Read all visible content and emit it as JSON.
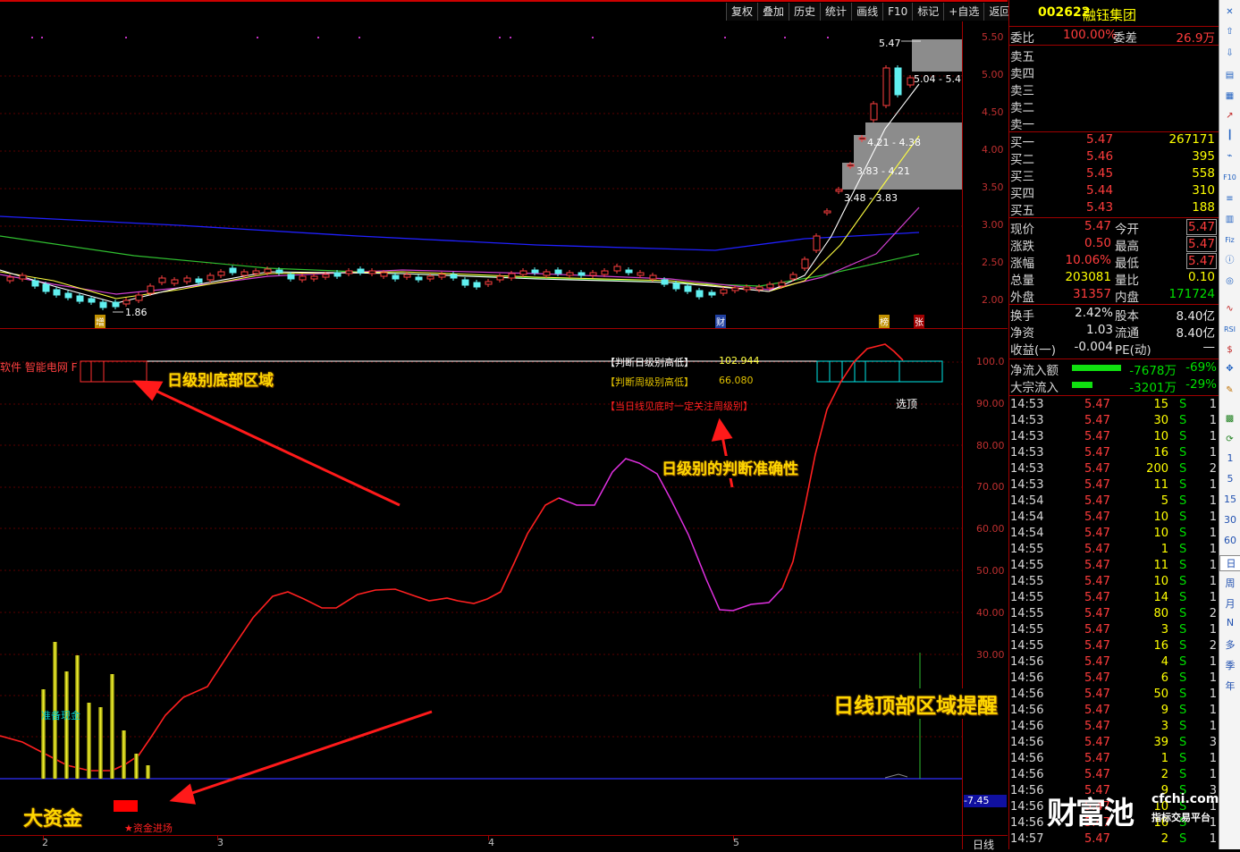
{
  "toolbar": [
    "复权",
    "叠加",
    "历史",
    "统计",
    "画线",
    "F10",
    "标记",
    "+自选",
    "返回"
  ],
  "stock": {
    "code": "002622",
    "name": "融钰集团"
  },
  "order_ratio": {
    "label1": "委比",
    "ratio": "100.00%",
    "label2": "委差",
    "diff": "26.9万"
  },
  "sell_levels": [
    "卖五",
    "卖四",
    "卖三",
    "卖二",
    "卖一"
  ],
  "buy_levels": [
    {
      "label": "买一",
      "price": "5.47",
      "vol": "267171"
    },
    {
      "label": "买二",
      "price": "5.46",
      "vol": "395"
    },
    {
      "label": "买三",
      "price": "5.45",
      "vol": "558"
    },
    {
      "label": "买四",
      "price": "5.44",
      "vol": "310"
    },
    {
      "label": "买五",
      "price": "5.43",
      "vol": "188"
    }
  ],
  "quote": [
    {
      "l1": "现价",
      "v1": "5.47",
      "l2": "今开",
      "v2": "5.47"
    },
    {
      "l1": "涨跌",
      "v1": "0.50",
      "l2": "最高",
      "v2": "5.47"
    },
    {
      "l1": "涨幅",
      "v1": "10.06%",
      "l2": "最低",
      "v2": "5.47"
    },
    {
      "l1": "总量",
      "v1": "203081",
      "l2": "量比",
      "v2": "0.10"
    },
    {
      "l1": "外盘",
      "v1": "31357",
      "l2": "内盘",
      "v2": "171724"
    }
  ],
  "fundamentals": [
    {
      "l1": "换手",
      "v1": "2.42%",
      "l2": "股本",
      "v2": "8.40亿"
    },
    {
      "l1": "净资",
      "v1": "1.03",
      "l2": "流通",
      "v2": "8.40亿"
    },
    {
      "l1": "收益(一)",
      "v1": "-0.004",
      "l2": "PE(动)",
      "v2": "—"
    }
  ],
  "flows": [
    {
      "label": "净流入额",
      "value": "-7678万",
      "pct": "-69%",
      "bar": 0.69
    },
    {
      "label": "大宗流入",
      "value": "-3201万",
      "pct": "-29%",
      "bar": 0.29
    }
  ],
  "ticks": [
    {
      "t": "14:53",
      "p": "5.47",
      "v": "15",
      "s": "S",
      "n": "1"
    },
    {
      "t": "14:53",
      "p": "5.47",
      "v": "30",
      "s": "S",
      "n": "1"
    },
    {
      "t": "14:53",
      "p": "5.47",
      "v": "10",
      "s": "S",
      "n": "1"
    },
    {
      "t": "14:53",
      "p": "5.47",
      "v": "16",
      "s": "S",
      "n": "1"
    },
    {
      "t": "14:53",
      "p": "5.47",
      "v": "200",
      "s": "S",
      "n": "2"
    },
    {
      "t": "14:53",
      "p": "5.47",
      "v": "11",
      "s": "S",
      "n": "1"
    },
    {
      "t": "14:54",
      "p": "5.47",
      "v": "5",
      "s": "S",
      "n": "1"
    },
    {
      "t": "14:54",
      "p": "5.47",
      "v": "10",
      "s": "S",
      "n": "1"
    },
    {
      "t": "14:54",
      "p": "5.47",
      "v": "10",
      "s": "S",
      "n": "1"
    },
    {
      "t": "14:55",
      "p": "5.47",
      "v": "1",
      "s": "S",
      "n": "1"
    },
    {
      "t": "14:55",
      "p": "5.47",
      "v": "11",
      "s": "S",
      "n": "1"
    },
    {
      "t": "14:55",
      "p": "5.47",
      "v": "10",
      "s": "S",
      "n": "1"
    },
    {
      "t": "14:55",
      "p": "5.47",
      "v": "14",
      "s": "S",
      "n": "1"
    },
    {
      "t": "14:55",
      "p": "5.47",
      "v": "80",
      "s": "S",
      "n": "2"
    },
    {
      "t": "14:55",
      "p": "5.47",
      "v": "3",
      "s": "S",
      "n": "1"
    },
    {
      "t": "14:55",
      "p": "5.47",
      "v": "16",
      "s": "S",
      "n": "2"
    },
    {
      "t": "14:56",
      "p": "5.47",
      "v": "4",
      "s": "S",
      "n": "1"
    },
    {
      "t": "14:56",
      "p": "5.47",
      "v": "6",
      "s": "S",
      "n": "1"
    },
    {
      "t": "14:56",
      "p": "5.47",
      "v": "50",
      "s": "S",
      "n": "1"
    },
    {
      "t": "14:56",
      "p": "5.47",
      "v": "9",
      "s": "S",
      "n": "1"
    },
    {
      "t": "14:56",
      "p": "5.47",
      "v": "3",
      "s": "S",
      "n": "1"
    },
    {
      "t": "14:56",
      "p": "5.47",
      "v": "39",
      "s": "S",
      "n": "3"
    },
    {
      "t": "14:56",
      "p": "5.47",
      "v": "1",
      "s": "S",
      "n": "1"
    },
    {
      "t": "14:56",
      "p": "5.47",
      "v": "2",
      "s": "S",
      "n": "1"
    },
    {
      "t": "14:56",
      "p": "5.47",
      "v": "9",
      "s": "S",
      "n": "3"
    },
    {
      "t": "14:56",
      "p": "5.47",
      "v": "10",
      "s": "S",
      "n": "1"
    },
    {
      "t": "14:56",
      "p": "5.47",
      "v": "16",
      "s": "S",
      "n": "1"
    },
    {
      "t": "14:57",
      "p": "5.47",
      "v": "2",
      "s": "S",
      "n": "1"
    }
  ],
  "price_axis": [
    "5.50",
    "5.00",
    "4.50",
    "4.00",
    "3.50",
    "3.00",
    "2.50",
    "2.00"
  ],
  "ind_axis": [
    "100.0",
    "90.00",
    "80.00",
    "70.00",
    "60.00",
    "50.00",
    "40.00",
    "30.00"
  ],
  "ind_current": "-7.45",
  "time_axis": [
    "2",
    "3",
    "4",
    "5"
  ],
  "period_label": "日线",
  "chart_labels": {
    "high": "5.47",
    "low": "1.86",
    "zone1": "5.04 - 5.47",
    "zone2": "4.21 - 4.38",
    "zone3": "3.83 - 4.21",
    "zone4": "3.48 - 3.83",
    "mark_zeng": "增",
    "mark_cai": "财",
    "mark_bang": "榜",
    "mark_zhang": "张"
  },
  "indicator": {
    "name": "软件 智能电网 F",
    "day_level_label": "【判断日级别高低】",
    "day_level_value": "102.944",
    "week_level_label": "【判断周级别高低】",
    "week_level_value": "66.080",
    "note": "【当日线见底时一定关注周级别】",
    "select_top": "选顶",
    "prep_funds": "准备现金",
    "fund_in": "★资金进场"
  },
  "annotations": {
    "bottom_zone": "日级别底部区域",
    "accuracy": "日级别的判断准确性",
    "top_alert": "日线顶部区域提醒",
    "big_money": "大资金"
  },
  "watermark": {
    "brand": "财富池",
    "site": "cfchi.com",
    "slogan": "指标交易平台"
  },
  "sidebar_periods": [
    "1",
    "5",
    "15",
    "30",
    "60",
    "日",
    "周",
    "月",
    "N",
    "多",
    "季",
    "年"
  ],
  "chart_data": {
    "type": "line",
    "title": "",
    "series": [
      {
        "name": "",
        "x": [
          0,
          0.5,
          1,
          1.5,
          2,
          2.5,
          3,
          3.5,
          4,
          4.5,
          5,
          5.5,
          6
        ],
        "values": [
          19,
          16,
          15,
          14,
          14,
          13,
          13,
          14,
          18,
          25,
          32,
          36,
          40
        ]
      }
    ],
    "ylim": [
      -7.45,
      105
    ]
  }
}
